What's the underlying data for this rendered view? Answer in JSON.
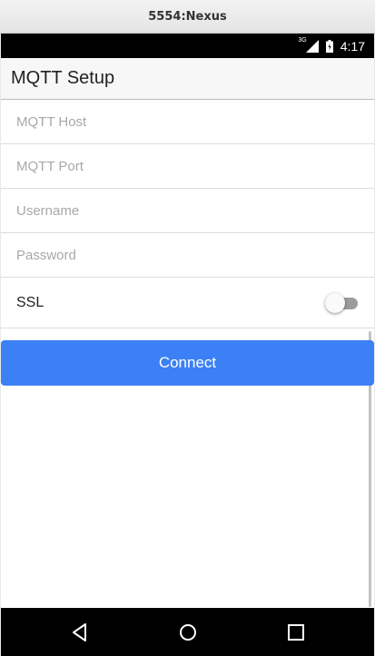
{
  "window": {
    "title": "5554:Nexus"
  },
  "status_bar": {
    "network": "3G",
    "time": "4:17"
  },
  "app_bar": {
    "title": "MQTT Setup"
  },
  "form": {
    "host": {
      "value": "",
      "placeholder": "MQTT Host"
    },
    "port": {
      "value": "",
      "placeholder": "MQTT Port"
    },
    "username": {
      "value": "",
      "placeholder": "Username"
    },
    "password": {
      "value": "",
      "placeholder": "Password"
    },
    "ssl": {
      "label": "SSL",
      "enabled": false
    }
  },
  "connect_button": {
    "label": "Connect"
  },
  "navigation": {
    "icons": [
      "back-icon",
      "home-icon",
      "recents-icon"
    ]
  },
  "colors": {
    "accent": "#3b80f4",
    "status_bar": "#000000",
    "app_bar": "#f7f7f7"
  }
}
